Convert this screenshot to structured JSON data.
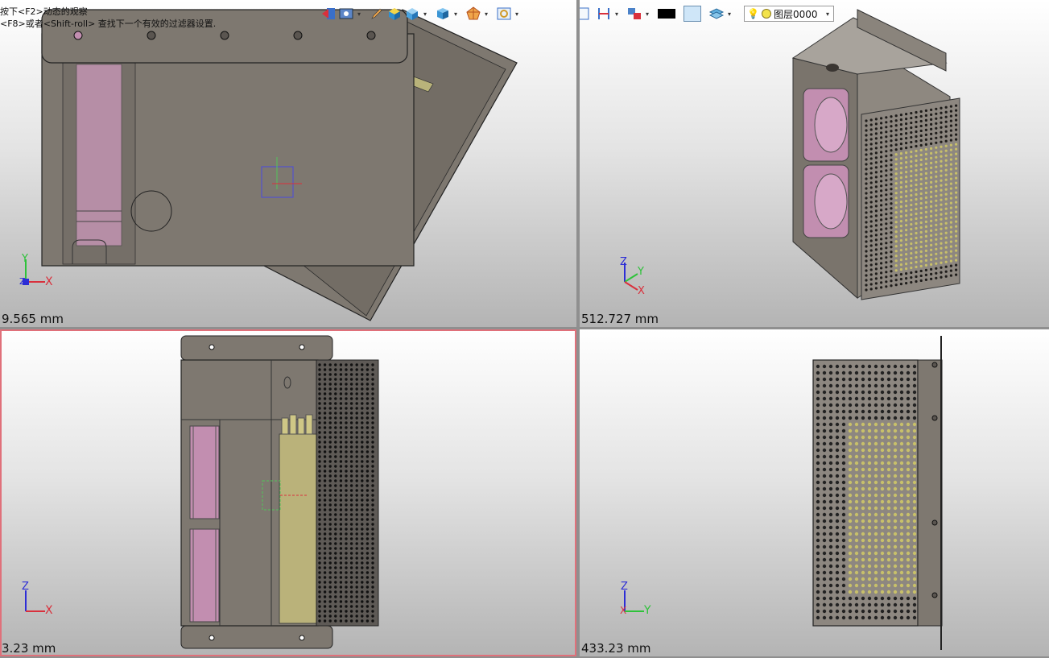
{
  "hints": {
    "line1": "按下<F2>动态的观察",
    "line2": "<F8>或者<Shift-roll> 查找下一个有效的过滤器设置."
  },
  "viewports": {
    "top_left": {
      "scale": "9.565 mm",
      "axis1": "Y",
      "axis2": "X",
      "axis3": "Z"
    },
    "top_right": {
      "scale": "512.727 mm",
      "axis1": "Z",
      "axis2": "Y",
      "axis3": "X"
    },
    "bottom_left": {
      "scale": "3.23 mm",
      "axis1": "Z",
      "axis2": "X"
    },
    "bottom_right": {
      "scale": "433.23 mm",
      "axis1": "Z",
      "axis2": "Y",
      "axis3": "X"
    }
  },
  "toolbar": {
    "layer_label": "图层0000",
    "icons": [
      "exit-icon",
      "view-icon",
      "pencil-icon",
      "cube-yellow-icon",
      "cube-blue-icon",
      "cube-shaded-icon",
      "render-icon",
      "view-target-icon",
      "view-frame-icon",
      "dimension-icon",
      "link-icon",
      "color-black-swatch",
      "color-light-swatch",
      "layers-icon",
      "bulb-icon"
    ]
  },
  "colors": {
    "accent_red": "#d9303c",
    "model_gray": "#7d776f",
    "fan_pink": "#c28eb0",
    "terminal_yellow": "#c8c06a",
    "active_border": "#e0707a"
  }
}
